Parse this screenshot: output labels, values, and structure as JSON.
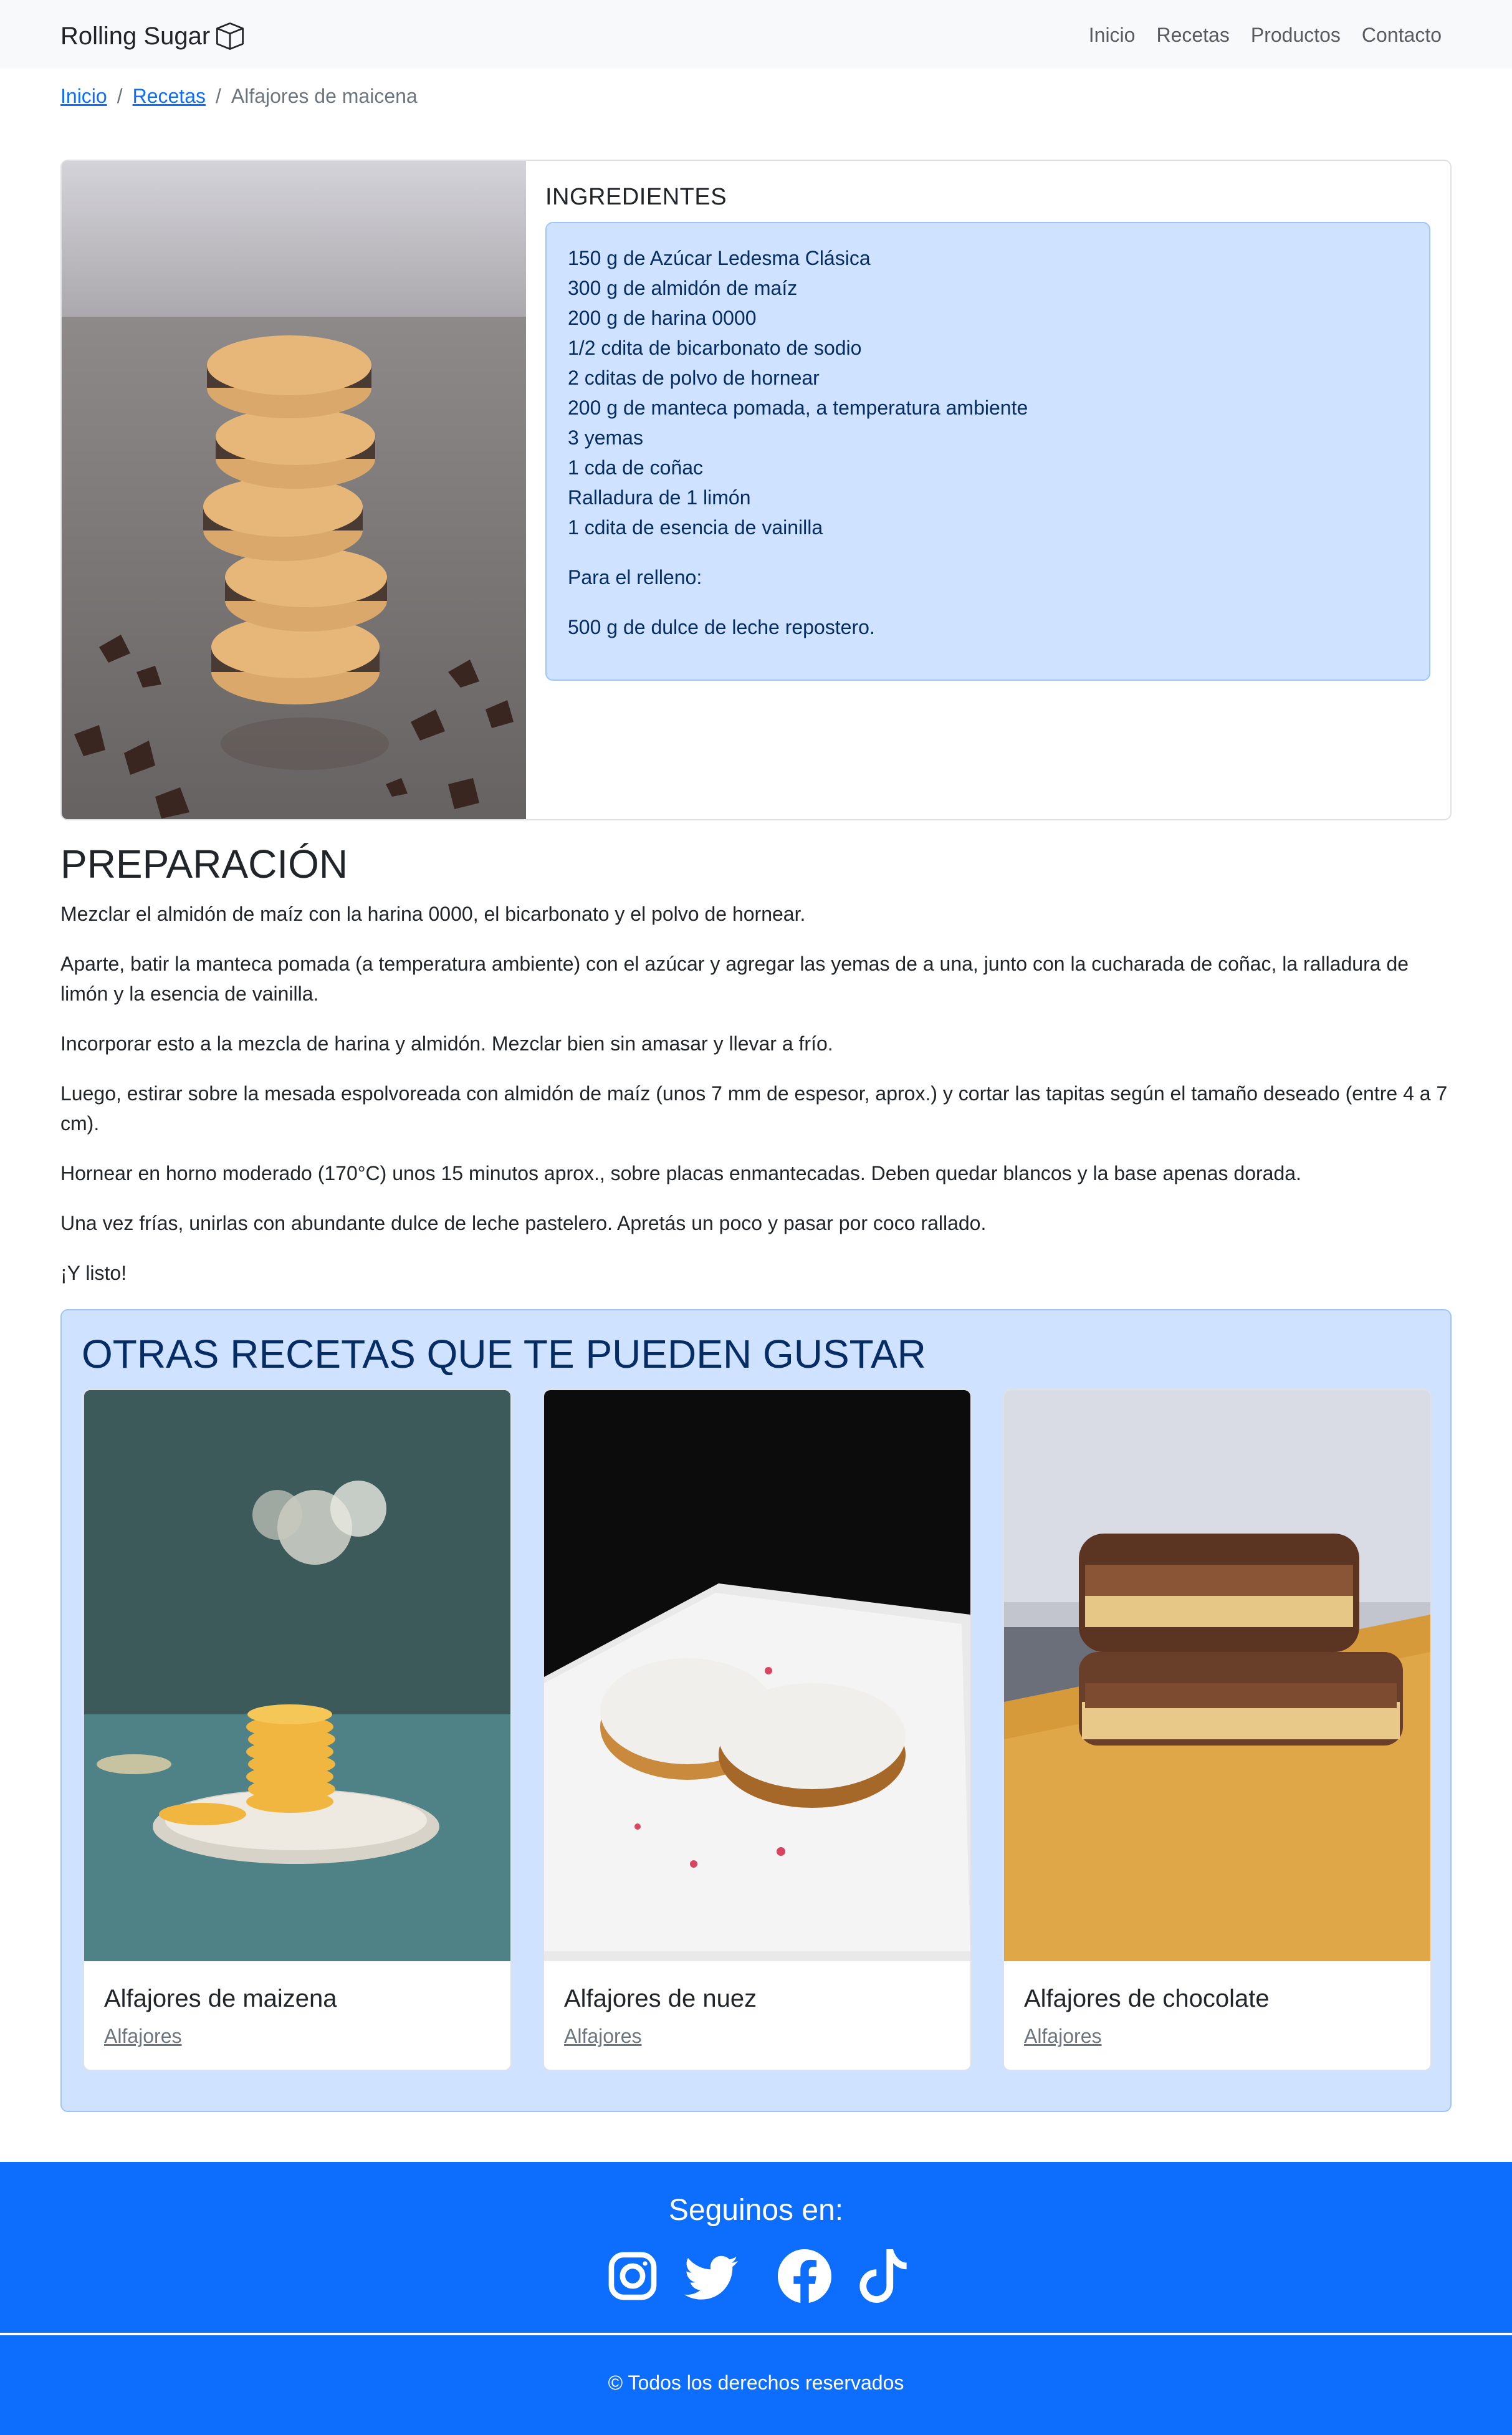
{
  "brand": {
    "name": "Rolling Sugar",
    "icon": "box-icon"
  },
  "nav": {
    "items": [
      "Inicio",
      "Recetas",
      "Productos",
      "Contacto"
    ]
  },
  "breadcrumb": {
    "home": "Inicio",
    "recipes": "Recetas",
    "current": "Alfajores de maicena"
  },
  "recipe": {
    "ingredients_title": "INGREDIENTES",
    "ingredients": [
      "150 g de Azúcar Ledesma Clásica",
      "300 g de almidón de maíz",
      "200 g de harina 0000",
      "1/2 cdita de bicarbonato de sodio",
      "2 cditas de polvo de hornear",
      "200 g de manteca pomada, a temperatura ambiente",
      "3 yemas",
      "1 cda de coñac",
      "Ralladura de 1 limón",
      "1 cdita de esencia de vainilla"
    ],
    "filling_label": "Para el relleno:",
    "filling": "500 g de dulce de leche repostero."
  },
  "preparation": {
    "title": "PREPARACIÓN",
    "steps": [
      "Mezclar el almidón de maíz con la harina 0000, el bicarbonato y el polvo de hornear.",
      "Aparte, batir la manteca pomada (a temperatura ambiente) con el azúcar y agregar las yemas de a una, junto con la cucharada de coñac, la ralladura de limón y la esencia de vainilla.",
      "Incorporar esto a la mezcla de harina y almidón. Mezclar bien sin amasar y llevar a frío.",
      "Luego, estirar sobre la mesada espolvoreada con almidón de maíz (unos 7 mm de espesor, aprox.) y cortar las tapitas según el tamaño deseado (entre 4 a 7 cm).",
      "Hornear en horno moderado (170°C) unos 15 minutos aprox., sobre placas enmantecadas. Deben quedar blancos y la base apenas dorada.",
      "Una vez frías, unirlas con abundante dulce de leche pastelero. Apretás un poco y pasar por coco rallado.",
      "¡Y listo!"
    ]
  },
  "other": {
    "title": "OTRAS RECETAS QUE TE PUEDEN GUSTAR",
    "cards": [
      {
        "title": "Alfajores de maizena",
        "category": "Alfajores"
      },
      {
        "title": "Alfajores de nuez",
        "category": "Alfajores"
      },
      {
        "title": "Alfajores de chocolate",
        "category": "Alfajores"
      }
    ]
  },
  "footer": {
    "follow": "Seguinos en:",
    "socials": [
      "instagram-icon",
      "twitter-icon",
      "facebook-icon",
      "tiktok-icon"
    ],
    "copyright": "© Todos los derechos reservados"
  },
  "colors": {
    "primary": "#0d6efd",
    "info_bg": "#cfe2ff",
    "info_border": "#9ec5fe",
    "info_text": "#052c65"
  }
}
